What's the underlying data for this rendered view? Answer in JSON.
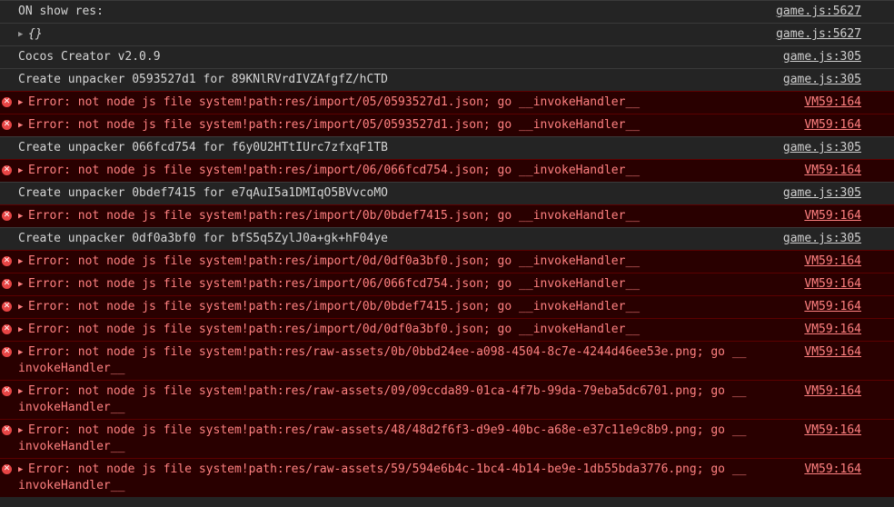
{
  "rows": [
    {
      "type": "log",
      "expand": false,
      "text": "ON show res:",
      "source": "game.js:5627"
    },
    {
      "type": "log",
      "expand": true,
      "text": "{}",
      "source": "game.js:5627",
      "italic": true
    },
    {
      "type": "log",
      "expand": false,
      "text": "Cocos Creator v2.0.9",
      "source": "game.js:305"
    },
    {
      "type": "log",
      "expand": false,
      "text": "Create unpacker 0593527d1 for 89KNlRVrdIVZAfgfZ/hCTD",
      "source": "game.js:305"
    },
    {
      "type": "error",
      "expand": true,
      "text": "Error: not node js file system!path:res/import/05/0593527d1.json; go __invokeHandler__",
      "source": "VM59:164"
    },
    {
      "type": "error",
      "expand": true,
      "text": "Error: not node js file system!path:res/import/05/0593527d1.json; go __invokeHandler__",
      "source": "VM59:164"
    },
    {
      "type": "log",
      "expand": false,
      "text": "Create unpacker 066fcd754 for f6y0U2HTtIUrc7zfxqF1TB",
      "source": "game.js:305"
    },
    {
      "type": "error",
      "expand": true,
      "text": "Error: not node js file system!path:res/import/06/066fcd754.json; go __invokeHandler__",
      "source": "VM59:164"
    },
    {
      "type": "log",
      "expand": false,
      "text": "Create unpacker 0bdef7415 for e7qAuI5a1DMIqO5BVvcoMO",
      "source": "game.js:305"
    },
    {
      "type": "error",
      "expand": true,
      "text": "Error: not node js file system!path:res/import/0b/0bdef7415.json; go __invokeHandler__",
      "source": "VM59:164"
    },
    {
      "type": "log",
      "expand": false,
      "text": "Create unpacker 0df0a3bf0 for bfS5q5ZylJ0a+gk+hF04ye",
      "source": "game.js:305"
    },
    {
      "type": "error",
      "expand": true,
      "text": "Error: not node js file system!path:res/import/0d/0df0a3bf0.json; go __invokeHandler__",
      "source": "VM59:164"
    },
    {
      "type": "error",
      "expand": true,
      "text": "Error: not node js file system!path:res/import/06/066fcd754.json; go __invokeHandler__",
      "source": "VM59:164"
    },
    {
      "type": "error",
      "expand": true,
      "text": "Error: not node js file system!path:res/import/0b/0bdef7415.json; go __invokeHandler__",
      "source": "VM59:164"
    },
    {
      "type": "error",
      "expand": true,
      "text": "Error: not node js file system!path:res/import/0d/0df0a3bf0.json; go __invokeHandler__",
      "source": "VM59:164"
    },
    {
      "type": "error",
      "expand": true,
      "text": "Error: not node js file system!path:res/raw-assets/0b/0bbd24ee-a098-4504-8c7e-4244d46ee53e.png; go __invokeHandler__",
      "source": "VM59:164"
    },
    {
      "type": "error",
      "expand": true,
      "text": "Error: not node js file system!path:res/raw-assets/09/09ccda89-01ca-4f7b-99da-79eba5dc6701.png; go __invokeHandler__",
      "source": "VM59:164"
    },
    {
      "type": "error",
      "expand": true,
      "text": "Error: not node js file system!path:res/raw-assets/48/48d2f6f3-d9e9-40bc-a68e-e37c11e9c8b9.png; go __invokeHandler__",
      "source": "VM59:164"
    },
    {
      "type": "error",
      "expand": true,
      "text": "Error: not node js file system!path:res/raw-assets/59/594e6b4c-1bc4-4b14-be9e-1db55bda3776.png; go __invokeHandler__",
      "source": "VM59:164"
    }
  ],
  "icons": {
    "error": "✕",
    "expand": "▶"
  }
}
